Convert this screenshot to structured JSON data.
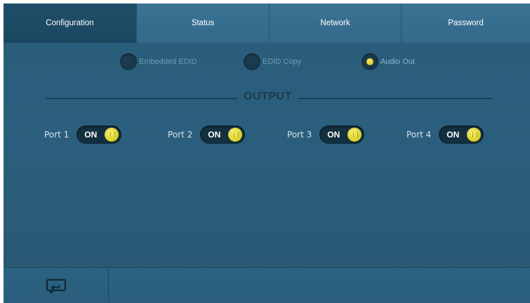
{
  "tabs": [
    {
      "label": "Configuration",
      "active": true
    },
    {
      "label": "Status",
      "active": false
    },
    {
      "label": "Network",
      "active": false
    },
    {
      "label": "Password",
      "active": false
    }
  ],
  "modes": [
    {
      "label": "Embedded EDID",
      "selected": false
    },
    {
      "label": "EDID Copy",
      "selected": false
    },
    {
      "label": "Audio Out",
      "selected": true
    }
  ],
  "output": {
    "title": "OUTPUT",
    "ports": [
      {
        "label": "Port 1",
        "state": "ON"
      },
      {
        "label": "Port 2",
        "state": "ON"
      },
      {
        "label": "Port 3",
        "state": "ON"
      },
      {
        "label": "Port 4",
        "state": "ON"
      }
    ]
  },
  "footer": {
    "return_icon": "return-icon"
  },
  "colors": {
    "accent_yellow": "#dfd634",
    "background": "#2a5c79"
  }
}
